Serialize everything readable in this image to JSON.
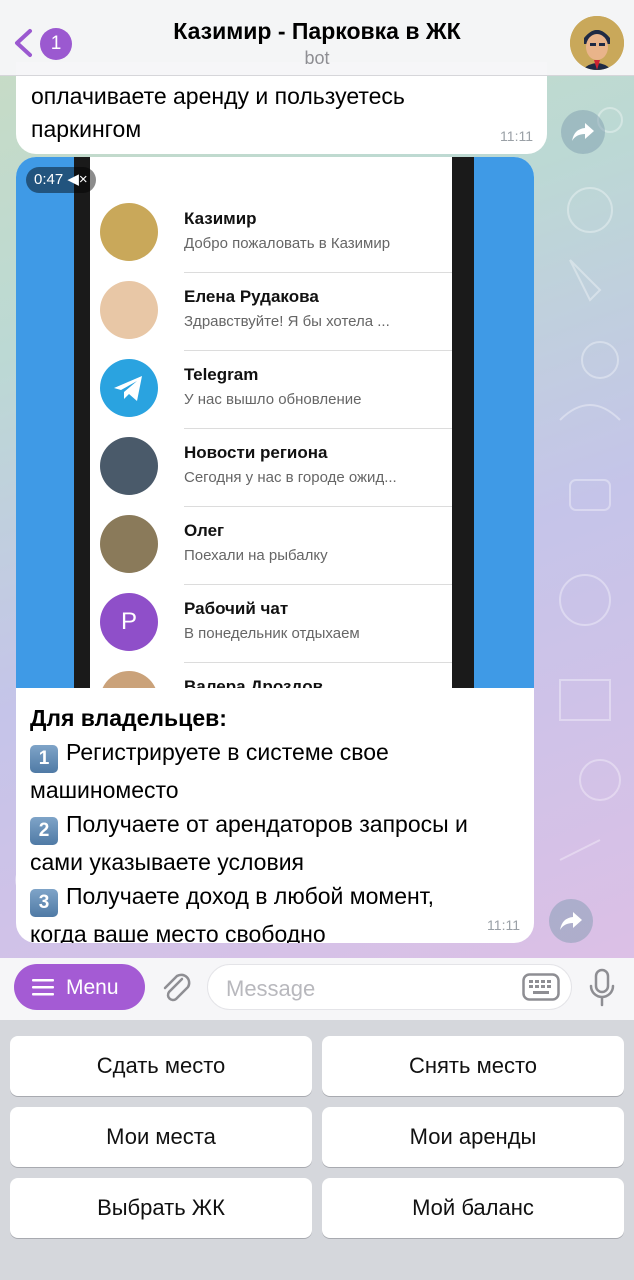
{
  "header": {
    "back_badge": "1",
    "title": "Казимир - Парковка в ЖК",
    "subtitle": "bot"
  },
  "message1": {
    "line1": "оплачиваете аренду и пользуетесь",
    "line2": "паркингом",
    "time": "11:11"
  },
  "video": {
    "duration": "0:47",
    "chats": [
      {
        "name": "Казимир",
        "preview": "Добро пожаловать в Казимир",
        "avatar": "cartoon-avatar",
        "color": "#c9a85a",
        "letter": ""
      },
      {
        "name": "Елена Рудакова",
        "preview": "Здравствуйте! Я бы хотела ...",
        "avatar": "photo-avatar",
        "color": "#e8c7a6",
        "letter": ""
      },
      {
        "name": "Telegram",
        "preview": "У нас вышло обновление",
        "avatar": "telegram-icon",
        "color": "#2aa3e0",
        "letter": ""
      },
      {
        "name": "Новости региона",
        "preview": "Сегодня у нас в городе ожид...",
        "avatar": "photo-avatar",
        "color": "#4a5a6a",
        "letter": ""
      },
      {
        "name": "Олег",
        "preview": "Поехали на рыбалку",
        "avatar": "photo-avatar",
        "color": "#8a7a5a",
        "letter": ""
      },
      {
        "name": "Рабочий чат",
        "preview": "В понедельник отдыхаем",
        "avatar": "letter-avatar",
        "color": "#8f4fc9",
        "letter": "P"
      },
      {
        "name": "Валера Дроздов",
        "preview": "",
        "avatar": "photo-avatar",
        "color": "#caa27a",
        "letter": ""
      }
    ]
  },
  "message2": {
    "heading": "Для владельцев:",
    "items": [
      {
        "num": "1",
        "text1": "Регистрируете в системе свое",
        "text2": "машиноместо"
      },
      {
        "num": "2",
        "text1": "Получаете от арендаторов запросы и",
        "text2": "сами указываете условия"
      },
      {
        "num": "3",
        "text1": "Получаете доход в любой момент,",
        "text2": "когда ваше место свободно"
      }
    ],
    "time": "11:11"
  },
  "inputbar": {
    "menu_label": "Menu",
    "placeholder": "Message"
  },
  "keyboard": {
    "buttons": [
      "Сдать место",
      "Снять место",
      "Мои места",
      "Мои аренды",
      "Выбрать ЖК",
      "Мой баланс"
    ]
  },
  "colors": {
    "accent": "#a45bd4",
    "telegram_blue": "#2aa3e0"
  }
}
